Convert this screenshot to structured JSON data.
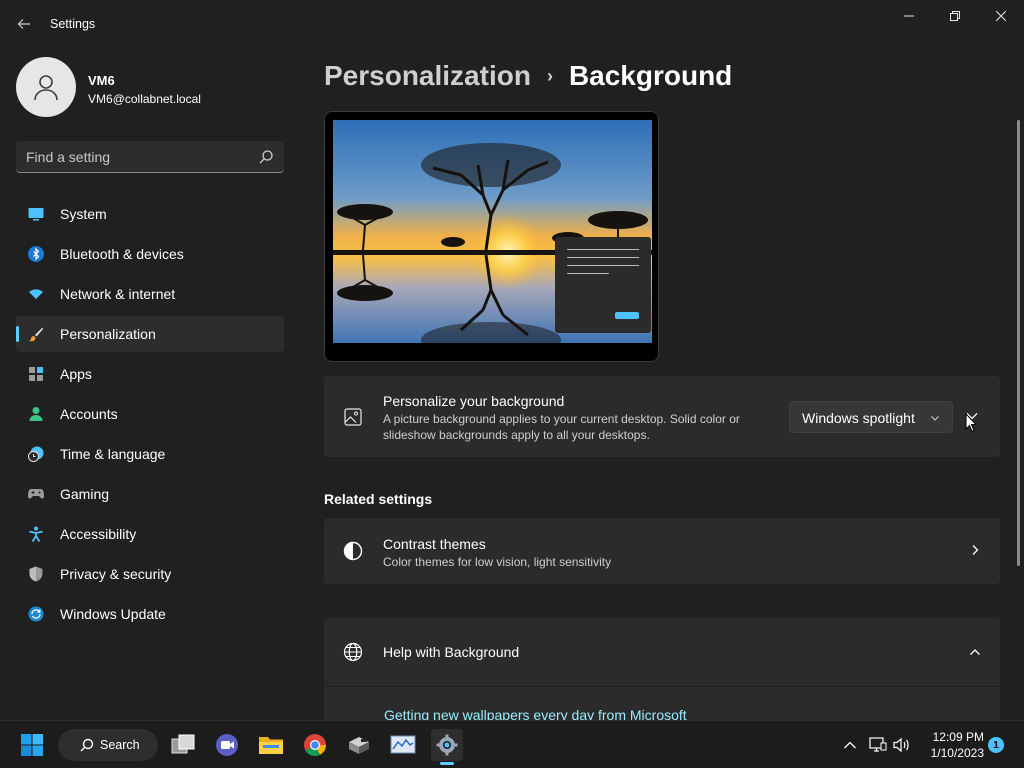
{
  "window": {
    "title": "Settings",
    "controls": {
      "minimize": "minimize",
      "maximize": "maximize",
      "close": "close"
    }
  },
  "profile": {
    "name": "VM6",
    "email": "VM6@collabnet.local"
  },
  "search": {
    "placeholder": "Find a setting"
  },
  "sidebar": {
    "items": [
      {
        "label": "System",
        "icon": "system-icon",
        "active": false
      },
      {
        "label": "Bluetooth & devices",
        "icon": "bluetooth-icon",
        "active": false
      },
      {
        "label": "Network & internet",
        "icon": "wifi-icon",
        "active": false
      },
      {
        "label": "Personalization",
        "icon": "brush-icon",
        "active": true
      },
      {
        "label": "Apps",
        "icon": "apps-icon",
        "active": false
      },
      {
        "label": "Accounts",
        "icon": "person-icon",
        "active": false
      },
      {
        "label": "Time & language",
        "icon": "clock-globe-icon",
        "active": false
      },
      {
        "label": "Gaming",
        "icon": "gamepad-icon",
        "active": false
      },
      {
        "label": "Accessibility",
        "icon": "accessibility-icon",
        "active": false
      },
      {
        "label": "Privacy & security",
        "icon": "shield-icon",
        "active": false
      },
      {
        "label": "Windows Update",
        "icon": "update-icon",
        "active": false
      }
    ]
  },
  "breadcrumb": {
    "parent": "Personalization",
    "separator": "›",
    "current": "Background"
  },
  "background_card": {
    "title": "Personalize your background",
    "description_line1": "A picture background applies to your current desktop. Solid color or",
    "description_line2": "slideshow backgrounds apply to all your desktops.",
    "dropdown_value": "Windows spotlight"
  },
  "related": {
    "heading": "Related settings",
    "contrast": {
      "title": "Contrast themes",
      "description": "Color themes for low vision, light sensitivity"
    }
  },
  "help": {
    "title": "Help with Background",
    "link": "Getting new wallpapers every day from Microsoft"
  },
  "taskbar": {
    "search_label": "Search",
    "time": "12:09 PM",
    "date": "1/10/2023",
    "notification_count": "1"
  },
  "colors": {
    "accent": "#60cdff",
    "window_bg": "#202020",
    "card_bg": "#2b2b2b",
    "link": "#99ebff"
  }
}
